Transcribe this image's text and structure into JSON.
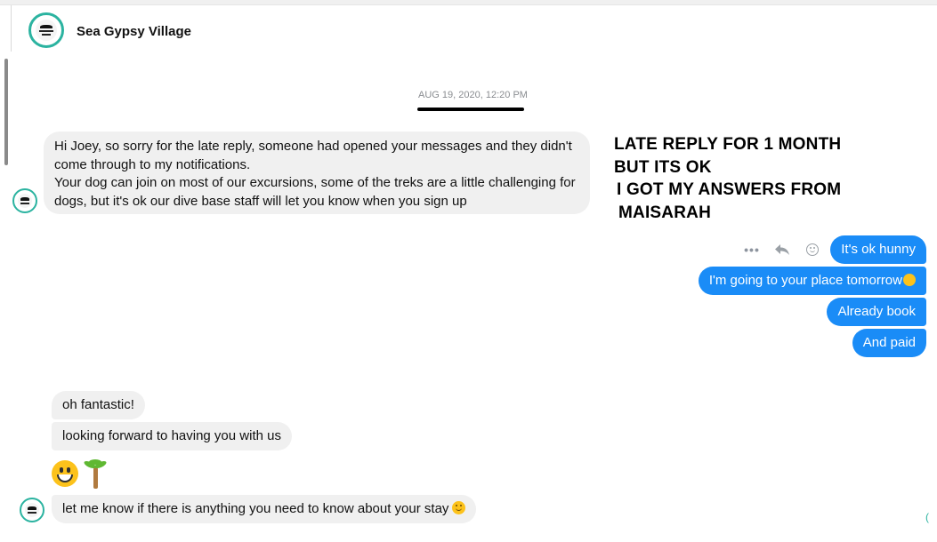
{
  "header": {
    "name": "Sea Gypsy Village",
    "avatar_icon": "travelers-choice-badge-icon"
  },
  "timestamp": "AUG 19, 2020, 12:20 PM",
  "incoming_first": {
    "lines": [
      "Hi Joey, so sorry for the late reply, someone had opened your messages and they didn't",
      "come through to my notifications.",
      "Your dog can join on most of our excursions, some of the treks are a little challenging for",
      "dogs, but it's ok our dive base staff will let you know when you sign up"
    ]
  },
  "annotation": {
    "lines": [
      "LATE REPLY FOR 1 MONTH",
      "BUT ITS OK",
      "I GOT MY ANSWERS FROM",
      "MAISARAH"
    ]
  },
  "message_actions": [
    "more-icon",
    "reply-icon",
    "react-icon"
  ],
  "outgoing": [
    "It's ok hunny",
    "I'm going to your place tomorrow",
    "Already book",
    "And paid"
  ],
  "incoming_second": [
    "oh fantastic!",
    "looking forward to having you with us",
    "let me know if there is anything you need to know about your stay"
  ],
  "emoji_message": [
    "grinning-face-icon",
    "palm-tree-icon"
  ],
  "colors": {
    "outgoing_bubble": "#1a8cf7",
    "incoming_bubble": "#f0f0f0",
    "avatar_ring": "#2bb3a0"
  }
}
